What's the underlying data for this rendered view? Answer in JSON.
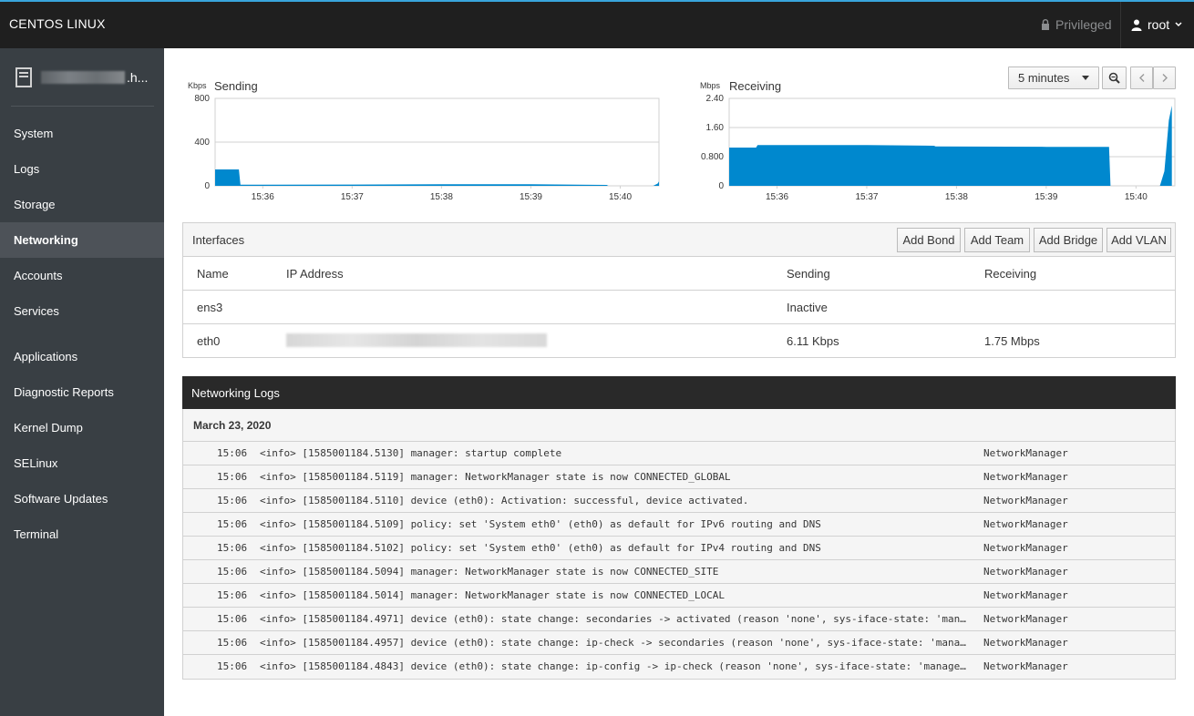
{
  "topbar": {
    "brand": "CENTOS LINUX",
    "privileged": "Privileged",
    "user": "root",
    "accent": "#39a5dc"
  },
  "sidebar": {
    "host_suffix": ".h...",
    "items": [
      {
        "label": "System"
      },
      {
        "label": "Logs"
      },
      {
        "label": "Storage"
      },
      {
        "label": "Networking",
        "active": true
      },
      {
        "label": "Accounts"
      },
      {
        "label": "Services"
      },
      {
        "label": "Applications"
      },
      {
        "label": "Diagnostic Reports"
      },
      {
        "label": "Kernel Dump"
      },
      {
        "label": "SELinux"
      },
      {
        "label": "Software Updates"
      },
      {
        "label": "Terminal"
      }
    ]
  },
  "toolbar": {
    "range": "5 minutes",
    "zoom_icon": "zoom-icon",
    "prev_icon": "chevron-left-icon",
    "next_icon": "chevron-right-icon"
  },
  "chart_data": [
    {
      "type": "area",
      "title": "Sending",
      "unit": "Kbps",
      "y_ticks": [
        "800",
        "400",
        "0"
      ],
      "ylim": [
        0,
        800
      ],
      "x_ticks": [
        "15:36",
        "15:37",
        "15:38",
        "15:39",
        "15:40"
      ],
      "x": [
        "15:35:28",
        "15:35:44",
        "15:35:45",
        "15:36:00",
        "15:37:00",
        "15:38:00",
        "15:39:00",
        "15:39:51",
        "15:39:52",
        "15:40:22",
        "15:40:25",
        "15:40:26"
      ],
      "values": [
        150,
        150,
        10,
        10,
        12,
        14,
        14,
        8,
        0,
        0,
        20,
        40
      ],
      "color": "#0088ce"
    },
    {
      "type": "area",
      "title": "Receiving",
      "unit": "Mbps",
      "y_ticks": [
        "2.40",
        "1.60",
        "0.800",
        "0"
      ],
      "ylim": [
        0,
        2.4
      ],
      "x_ticks": [
        "15:36",
        "15:37",
        "15:38",
        "15:39",
        "15:40"
      ],
      "x": [
        "15:35:28",
        "15:35:46",
        "15:35:47",
        "15:37:00",
        "15:37:45",
        "15:37:46",
        "15:39:00",
        "15:39:42",
        "15:39:43",
        "15:40:16",
        "15:40:19",
        "15:40:22",
        "15:40:24"
      ],
      "values": [
        1.05,
        1.05,
        1.12,
        1.12,
        1.1,
        1.08,
        1.07,
        1.07,
        0,
        0,
        0.4,
        1.8,
        2.2
      ],
      "color": "#0088ce"
    }
  ],
  "interfaces": {
    "title": "Interfaces",
    "buttons": [
      "Add Bond",
      "Add Team",
      "Add Bridge",
      "Add VLAN"
    ],
    "columns": [
      "Name",
      "IP Address",
      "Sending",
      "Receiving"
    ],
    "rows": [
      {
        "name": "ens3",
        "ip": "",
        "sending": "Inactive",
        "receiving": ""
      },
      {
        "name": "eth0",
        "ip": "",
        "sending": "6.11 Kbps",
        "receiving": "1.75 Mbps"
      }
    ]
  },
  "logs": {
    "title": "Networking Logs",
    "date": "March 23, 2020",
    "entries": [
      {
        "time": "15:06",
        "message": "<info> [1585001184.5130] manager: startup complete",
        "ident": "NetworkManager"
      },
      {
        "time": "15:06",
        "message": "<info> [1585001184.5119] manager: NetworkManager state is now CONNECTED_GLOBAL",
        "ident": "NetworkManager"
      },
      {
        "time": "15:06",
        "message": "<info> [1585001184.5110] device (eth0): Activation: successful, device activated.",
        "ident": "NetworkManager"
      },
      {
        "time": "15:06",
        "message": "<info> [1585001184.5109] policy: set 'System eth0' (eth0) as default for IPv6 routing and DNS",
        "ident": "NetworkManager"
      },
      {
        "time": "15:06",
        "message": "<info> [1585001184.5102] policy: set 'System eth0' (eth0) as default for IPv4 routing and DNS",
        "ident": "NetworkManager"
      },
      {
        "time": "15:06",
        "message": "<info> [1585001184.5094] manager: NetworkManager state is now CONNECTED_SITE",
        "ident": "NetworkManager"
      },
      {
        "time": "15:06",
        "message": "<info> [1585001184.5014] manager: NetworkManager state is now CONNECTED_LOCAL",
        "ident": "NetworkManager"
      },
      {
        "time": "15:06",
        "message": "<info> [1585001184.4971] device (eth0): state change: secondaries -> activated (reason 'none', sys-iface-state: 'man…",
        "ident": "NetworkManager"
      },
      {
        "time": "15:06",
        "message": "<info> [1585001184.4957] device (eth0): state change: ip-check -> secondaries (reason 'none', sys-iface-state: 'mana…",
        "ident": "NetworkManager"
      },
      {
        "time": "15:06",
        "message": "<info> [1585001184.4843] device (eth0): state change: ip-config -> ip-check (reason 'none', sys-iface-state: 'manage…",
        "ident": "NetworkManager"
      }
    ]
  }
}
